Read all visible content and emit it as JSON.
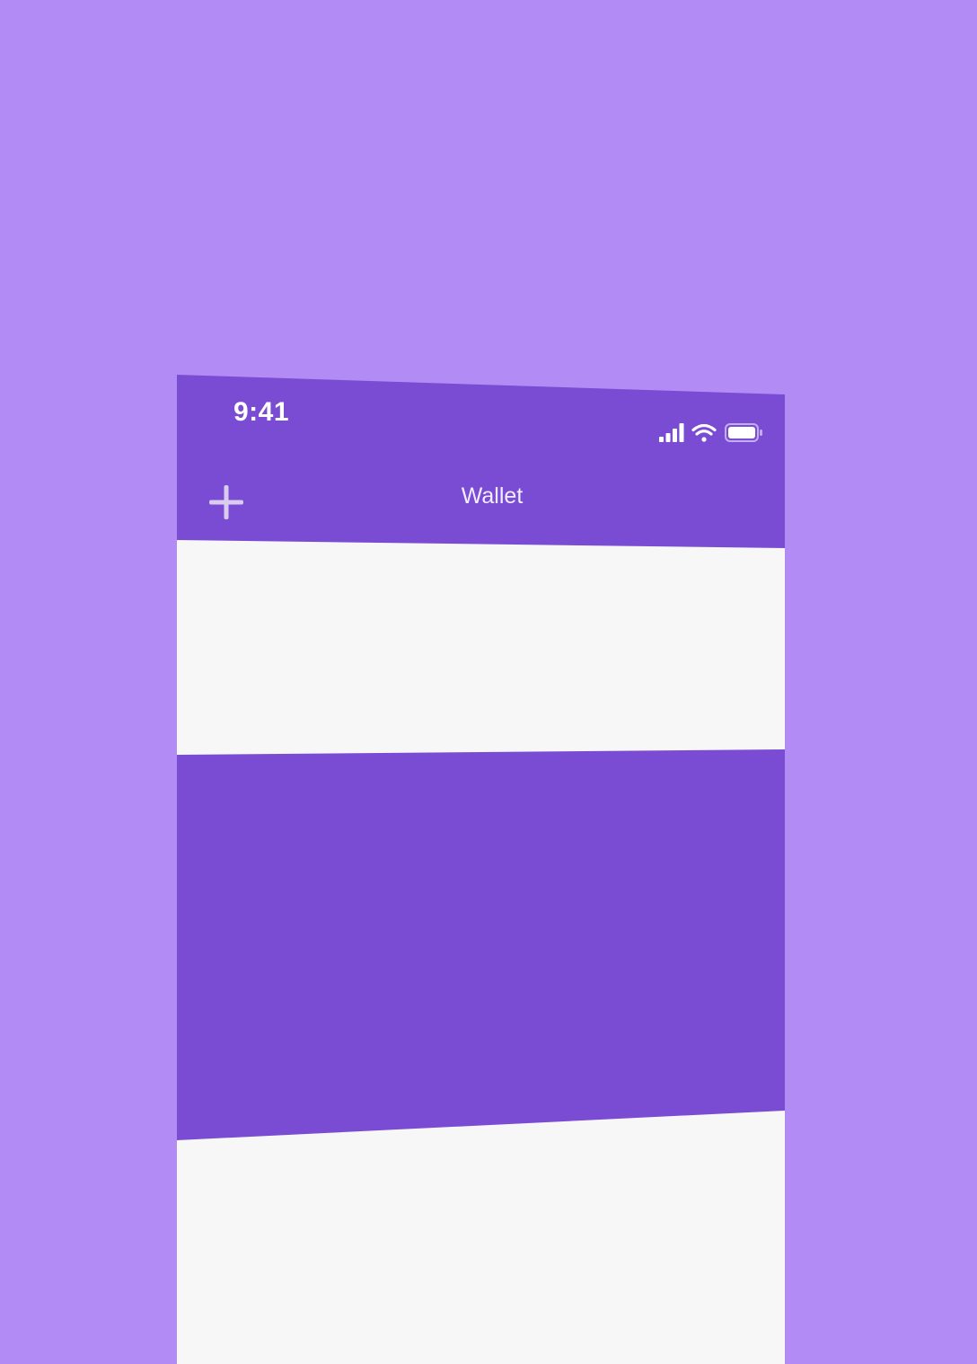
{
  "colors": {
    "backdrop": "#B38BF5",
    "accent": "#7A4CD4",
    "surface": "#F7F7F7",
    "on_accent": "#FFFFFF",
    "add_icon": "#D9CCEF"
  },
  "status_bar": {
    "time": "9:41",
    "icons": [
      "cellular-signal-icon",
      "wifi-icon",
      "battery-icon"
    ]
  },
  "nav_bar": {
    "title": "Wallet",
    "add_icon": "plus-icon"
  }
}
